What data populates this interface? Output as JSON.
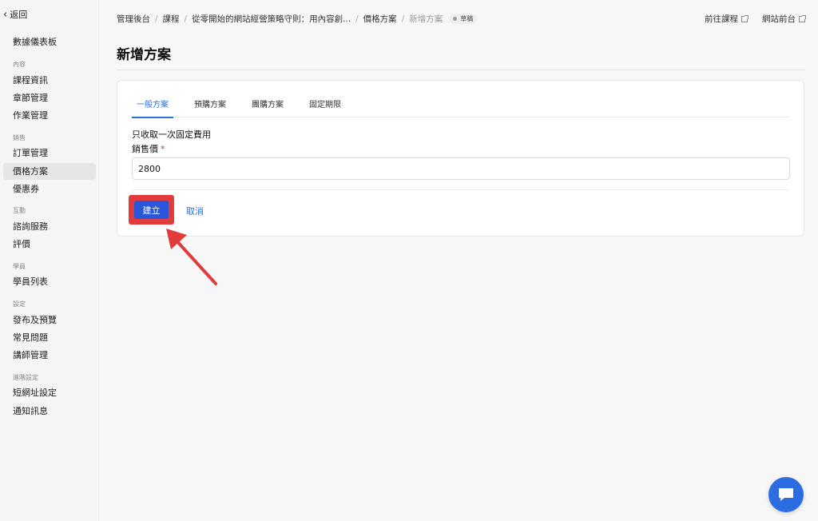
{
  "sidebar": {
    "back_label": "返回",
    "dashboard": "數據儀表板",
    "groups": {
      "content": "內容",
      "sales": "銷售",
      "interaction": "互動",
      "students": "學員",
      "settings": "設定",
      "advanced": "進階設定"
    },
    "items": {
      "course_info": "課程資訊",
      "chapters": "章節管理",
      "assignments": "作業管理",
      "orders": "訂單管理",
      "pricing": "價格方案",
      "coupons": "優惠券",
      "consulting": "諮詢服務",
      "reviews": "評價",
      "student_list": "學員列表",
      "publish": "發布及預覽",
      "faq": "常見問題",
      "instructors": "講師管理",
      "short_url": "短網址設定",
      "notifications": "通知訊息"
    }
  },
  "breadcrumb": {
    "admin": "管理後台",
    "courses": "課程",
    "course_name": "從零開始的網站經營策略守則：用內容創...",
    "pricing": "價格方案",
    "current": "新增方案",
    "status": "草稿"
  },
  "toplinks": {
    "go_course": "前往課程",
    "site_front": "網站前台"
  },
  "page_title": "新增方案",
  "tabs": [
    "一般方案",
    "預購方案",
    "團購方案",
    "固定期限"
  ],
  "form": {
    "description": "只收取一次固定費用",
    "price_label": "銷售價",
    "required_mark": "*",
    "price_value": "2800"
  },
  "actions": {
    "create": "建立",
    "cancel": "取消"
  },
  "colors": {
    "primary": "#2b56d9",
    "link": "#2f6fd8",
    "highlight": "#e23b3b",
    "chat": "#2b6de0"
  }
}
